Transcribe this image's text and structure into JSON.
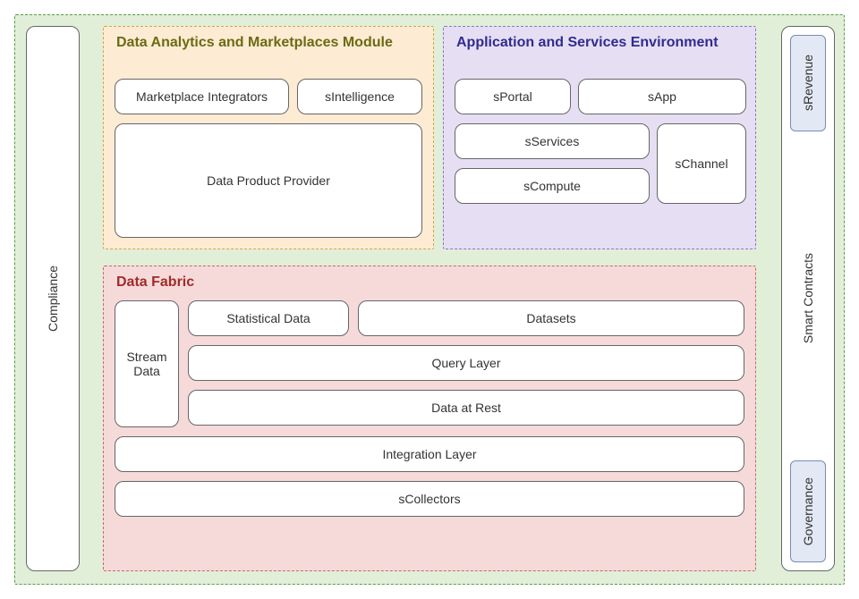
{
  "compliance": "Compliance",
  "smart_contracts": "Smart Contracts",
  "s_revenue": "sRevenue",
  "governance": "Governance",
  "analytics": {
    "title": "Data Analytics and Marketplaces Module",
    "marketplace_integrators": "Marketplace Integrators",
    "s_intelligence": "sIntelligence",
    "data_product_provider": "Data Product Provider"
  },
  "app_env": {
    "title": "Application and Services Environment",
    "s_portal": "sPortal",
    "s_app": "sApp",
    "s_services": "sServices",
    "s_compute": "sCompute",
    "s_channel": "sChannel"
  },
  "fabric": {
    "title": "Data Fabric",
    "stream_data": "Stream\nData",
    "statistical_data": "Statistical Data",
    "datasets": "Datasets",
    "query_layer": "Query Layer",
    "data_at_rest": "Data at Rest",
    "integration_layer": "Integration Layer",
    "s_collectors": "sCollectors"
  }
}
